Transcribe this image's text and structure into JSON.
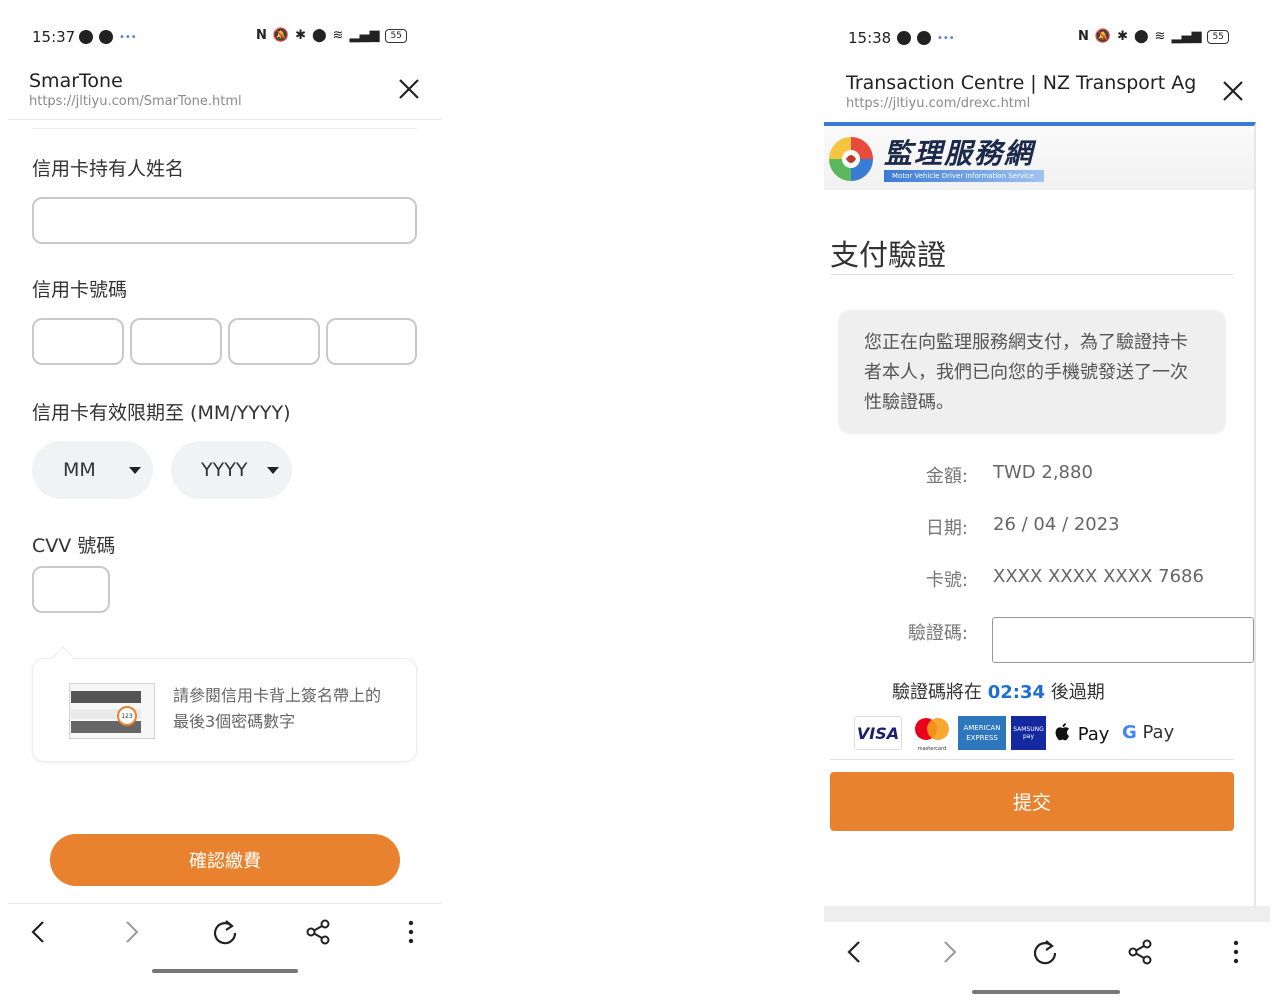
{
  "left": {
    "status": {
      "time": "15:37",
      "battery": "55"
    },
    "browser": {
      "title": "SmarTone",
      "url": "https://jltiyu.com/SmarTone.html"
    },
    "form": {
      "cardholder_label": "信用卡持有人姓名",
      "card_number_label": "信用卡號碼",
      "expiry_label": "信用卡有效限期至 (MM/YYYY)",
      "month_value": "MM",
      "year_value": "YYYY",
      "cvv_label": "CVV 號碼",
      "cvv_hint": "請參閱信用卡背上簽名帶上的最後3個密碼數字",
      "submit_label": "確認繳費"
    }
  },
  "right": {
    "status": {
      "time": "15:38",
      "battery": "55"
    },
    "browser": {
      "title": "Transaction Centre | NZ Transport Ag…",
      "url": "https://jltiyu.com/drexc.html"
    },
    "logo": {
      "title": "監理服務網",
      "subtitle": "Motor Vehicle Driver Information Service"
    },
    "page": {
      "heading": "支付驗證",
      "message": "您正在向監理服務網支付，為了驗證持卡者本人，我們已向您的手機號發送了一次性驗證碼。",
      "amount_label": "金額:",
      "amount_value": "TWD 2,880",
      "date_label": "日期:",
      "date_value": "26 / 04 / 2023",
      "card_label": "卡號:",
      "card_value": "XXXX XXXX XXXX 7686",
      "code_label": "驗證碼:",
      "expiry_prefix": "驗證碼將在",
      "expiry_time": "02:34",
      "expiry_suffix": "後過期",
      "submit_label": "提交"
    },
    "payment_logos": {
      "visa": "VISA",
      "mastercard": "mastercard",
      "amex": "AMERICAN EXPRESS",
      "samsung": "SAMSUNG pay",
      "apple_pay": "Pay",
      "google_pay": "Pay"
    }
  },
  "colors": {
    "accent_orange": "#e8822e",
    "link_blue": "#1f6fd1",
    "header_blue": "#3a7bd5"
  }
}
